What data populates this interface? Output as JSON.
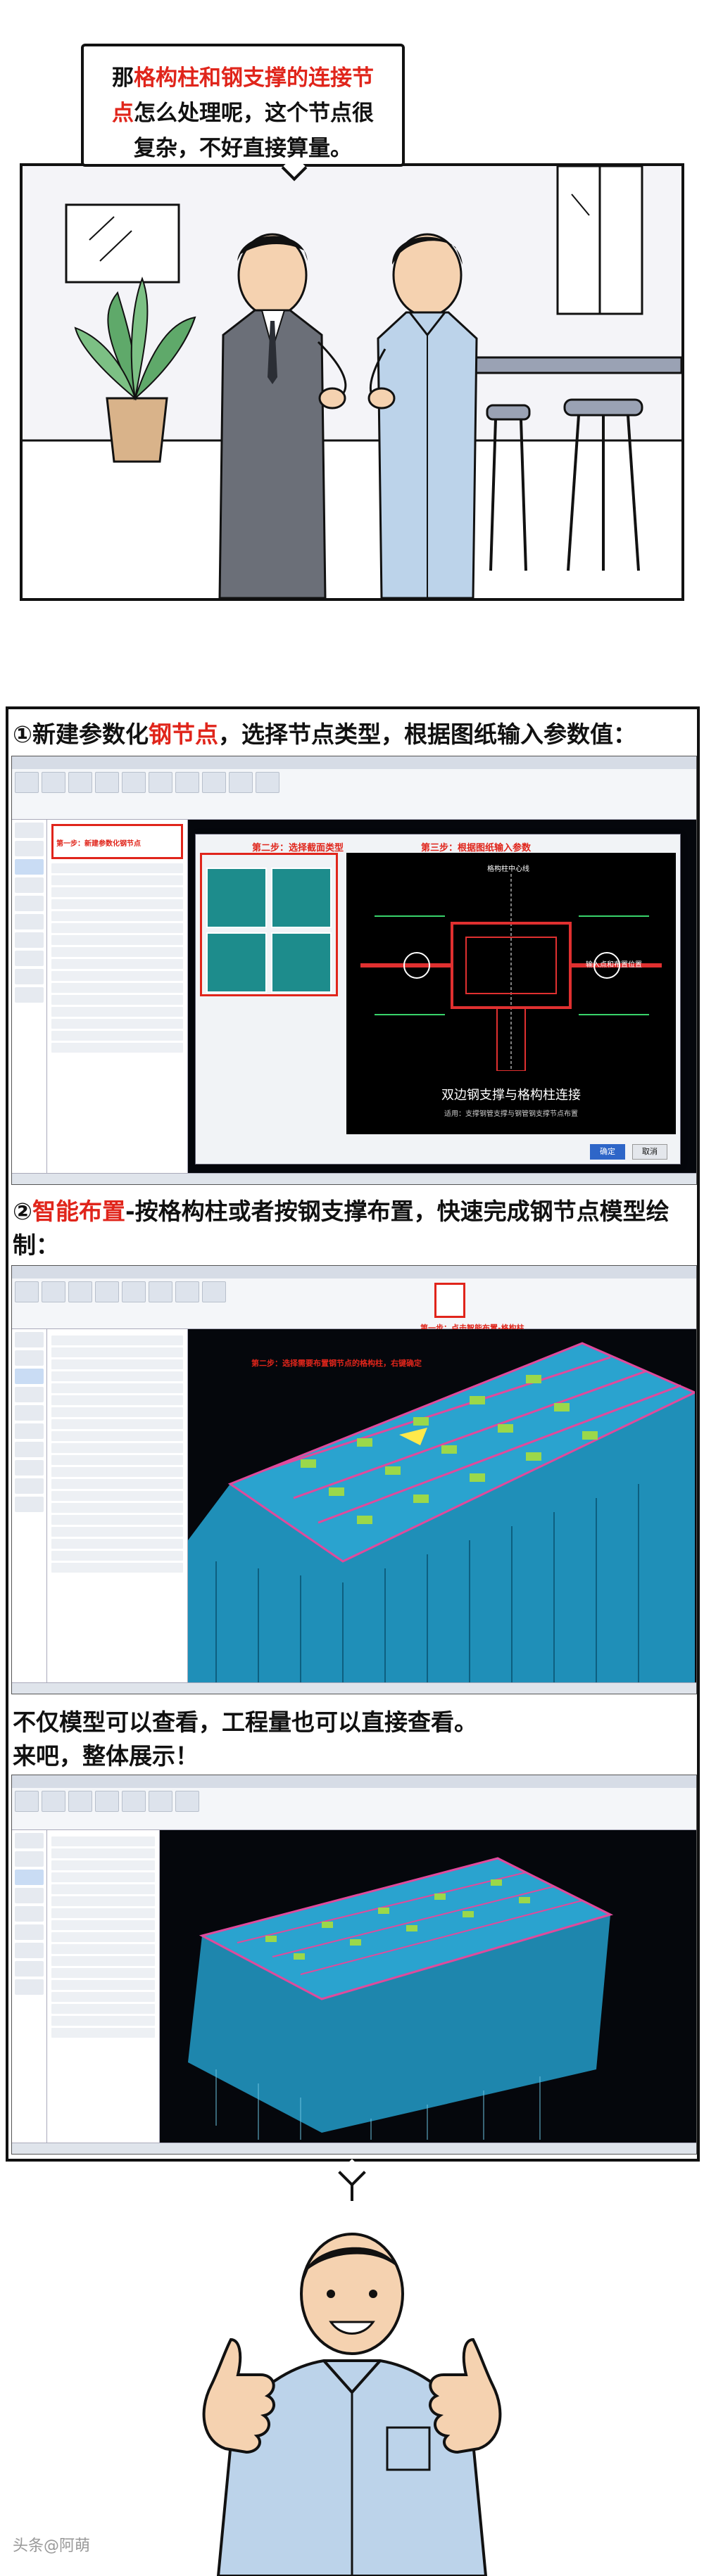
{
  "panel1": {
    "bubble_line1_pre": "那",
    "bubble_line1_red": "格构柱和钢支撑的连接节",
    "bubble_line2_red": "点",
    "bubble_line2_post": "怎么处理呢，这个节点很",
    "bubble_line3": "复杂，不好直接算量。"
  },
  "panel2": {
    "step1": {
      "caption_pre": "①新建参数化",
      "caption_red": "钢节点",
      "caption_post": "，选择节点类型，根据图纸输入参数值：",
      "step_a": "第一步：新建参数化钢节点",
      "step_b": "第二步：选择截面类型",
      "step_c": "第三步：根据图纸输入参数",
      "diagram_title": "双边钢支撑与格构柱连接",
      "diagram_sub": "适用：支撑钢管支撑与钢管钢支撑节点布置",
      "diagram_label_center": "格构柱中心线",
      "diagram_label_right": "输入点和布置位置",
      "ok_label": "确定",
      "cancel_label": "取消"
    },
    "step2": {
      "caption_pre": "②",
      "caption_red": "智能布置",
      "caption_post": "-按格构柱或者按钢支撑布置，快速完成钢节点模型绘制：",
      "step_a": "第一步：点击智能布置-格构柱",
      "step_b": "第二步：选择需要布置钢节点的格构柱，右键确定"
    },
    "step3": {
      "caption_line1": "不仅模型可以查看，工程量也可以直接查看。",
      "caption_line2": "来吧，整体展示！"
    }
  },
  "watermark": "头条@阿萌"
}
